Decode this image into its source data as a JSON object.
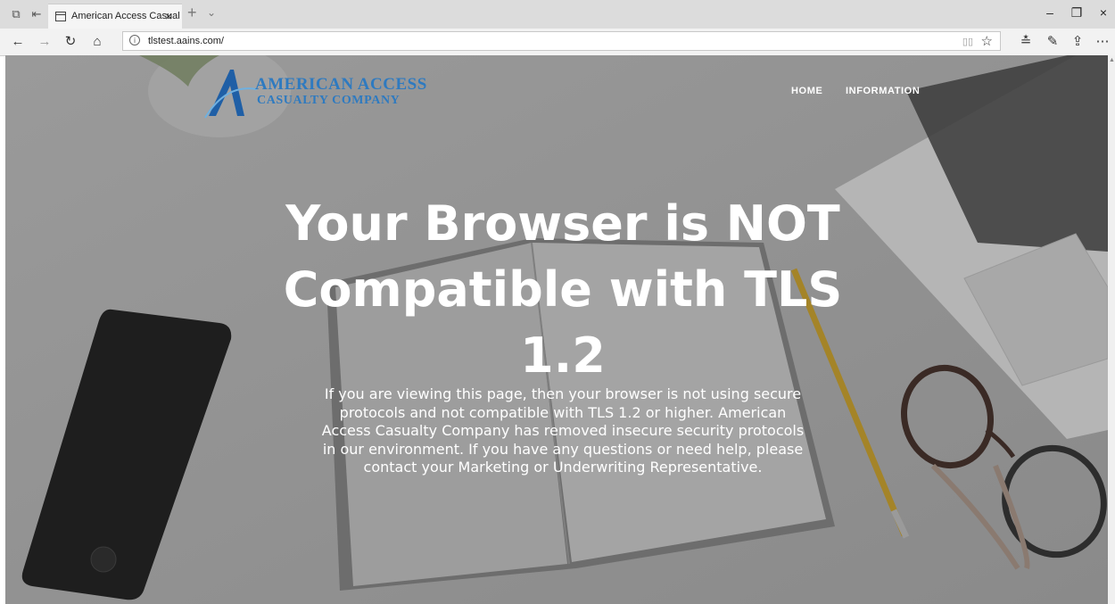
{
  "browser": {
    "tab_title": "American Access Casual",
    "new_tab_symbol": "+",
    "tab_menu_symbol": "⌄",
    "close_symbol": "×",
    "url": "tlstest.aains.com/",
    "window_controls": {
      "minimize": "–",
      "maximize": "❐",
      "close": "×"
    }
  },
  "site": {
    "logo": {
      "line1": "AMERICAN ACCESS",
      "line2": "CASUALTY COMPANY",
      "brand_color": "#2e7ac0"
    },
    "nav": [
      {
        "label": "HOME"
      },
      {
        "label": "INFORMATION"
      }
    ],
    "headline": "Your Browser is NOT Compatible with TLS 1.2",
    "message": "If you are viewing this page, then your browser is not using secure protocols and not compatible with TLS 1.2 or higher. American Access Casualty Company has removed insecure security protocols in our environment. If you have any questions or need help, please contact your Marketing or Underwriting Representative."
  }
}
